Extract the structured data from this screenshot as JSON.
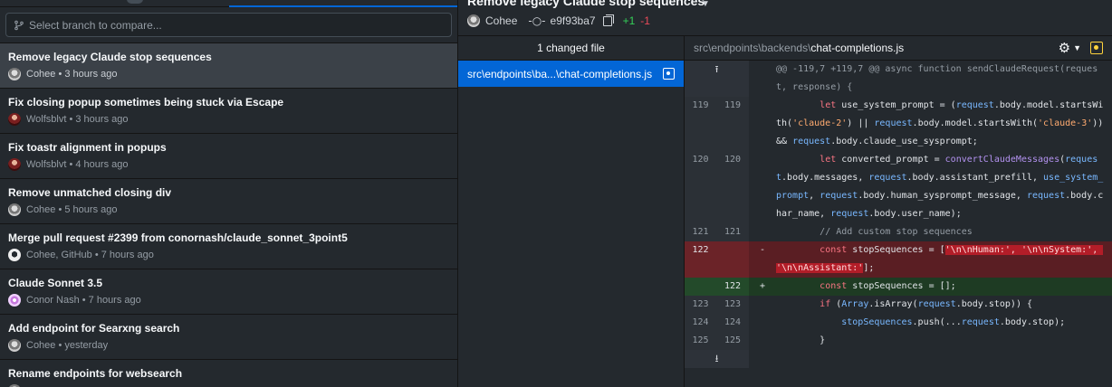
{
  "search": {
    "placeholder": "Select branch to compare..."
  },
  "commits": [
    {
      "title": "Remove legacy Claude stop sequences",
      "meta": "Cohee • 3 hours ago",
      "avatar": "cohee-avatar"
    },
    {
      "title": "Fix closing popup sometimes being stuck via Escape",
      "meta": "Wolfsblvt • 3 hours ago",
      "avatar": "wolfsblvt-avatar"
    },
    {
      "title": "Fix toastr alignment in popups",
      "meta": "Wolfsblvt • 4 hours ago",
      "avatar": "wolfsblvt-avatar"
    },
    {
      "title": "Remove unmatched closing div",
      "meta": "Cohee • 5 hours ago",
      "avatar": "cohee-avatar"
    },
    {
      "title": "Merge pull request #2399 from conornash/claude_sonnet_3point5",
      "meta": "Cohee, GitHub • 7 hours ago",
      "avatar": "github-avatar"
    },
    {
      "title": "Claude Sonnet 3.5",
      "meta": "Conor Nash • 7 hours ago",
      "avatar": "conor-avatar"
    },
    {
      "title": "Add endpoint for Searxng search",
      "meta": "Cohee • yesterday",
      "avatar": "cohee-avatar"
    },
    {
      "title": "Rename endpoints for websearch",
      "meta": "",
      "avatar": "cohee-avatar"
    }
  ],
  "header": {
    "title": "Remove legacy Claude stop sequences",
    "author": "Cohee",
    "sha": "e9f93ba7",
    "added": "+1",
    "deleted": "-1"
  },
  "files": {
    "heading": "1 changed file",
    "items": [
      {
        "name": "src\\endpoints\\ba...\\chat-completions.js",
        "status": "modified"
      }
    ]
  },
  "diff": {
    "path_prefix": "src\\endpoints\\backends\\",
    "path_file": "chat-completions.js",
    "hunk": "@@ -119,7 +119,7 @@ async function sendClaudeRequest(request, response) {",
    "lines": [
      {
        "old": "119",
        "new": "119"
      },
      {
        "old": "120",
        "new": "120"
      },
      {
        "old": "121",
        "new": "121"
      },
      {
        "old": "122",
        "new": "",
        "sign": "-"
      },
      {
        "old": "",
        "new": "122",
        "sign": "+"
      },
      {
        "old": "123",
        "new": "123"
      },
      {
        "old": "124",
        "new": "124"
      },
      {
        "old": "125",
        "new": "125"
      }
    ]
  },
  "colors": {
    "accent": "#0366d6",
    "added": "#34d058",
    "deleted": "#ea4a5a"
  }
}
